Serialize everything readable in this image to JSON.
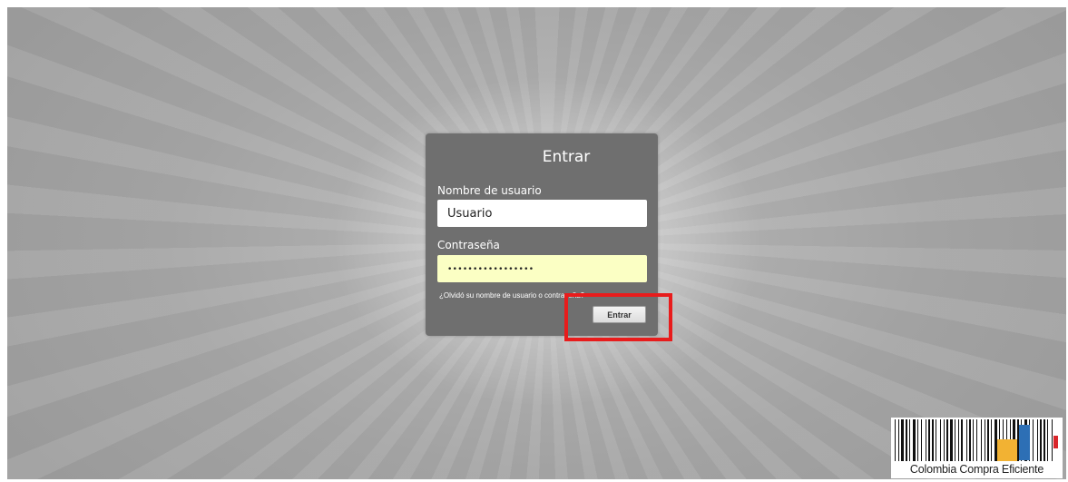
{
  "login": {
    "title": "Entrar",
    "username_label": "Nombre de usuario",
    "username_value": "Usuario",
    "password_label": "Contraseña",
    "password_value": "•••••••••••••••••",
    "forgot_link": "¿Olvidó su nombre de usuario o contraseña?",
    "submit_label": "Entrar"
  },
  "brand": {
    "name": "Colombia Compra Eficiente",
    "colors": {
      "yellow": "#f2b233",
      "blue": "#2d6fb5",
      "red": "#d9262b"
    }
  },
  "highlight": {
    "color": "#e81c1c",
    "target": "submit-button"
  }
}
